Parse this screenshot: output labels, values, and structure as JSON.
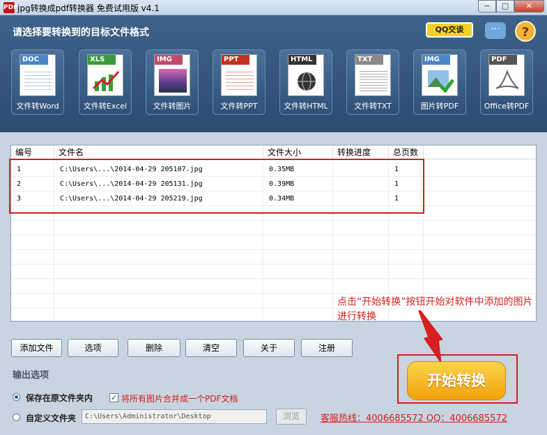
{
  "window": {
    "icon_text": "PDF",
    "title": "jpg转换成pdf转换器 免费试用版 v4.1",
    "min": "−",
    "max": "□",
    "close": "✕"
  },
  "header": {
    "title": "请选择要转换到的目标文件格式",
    "qq_label": "QQ交谈",
    "chat_glyph": "···",
    "help_glyph": "?"
  },
  "tools": [
    {
      "tag": "DOC",
      "tag_color": "#4a86c8",
      "label": "文件转Word",
      "icon": "word-doc-icon"
    },
    {
      "tag": "XLS",
      "tag_color": "#3a9a3a",
      "label": "文件转Excel",
      "icon": "excel-chart-icon"
    },
    {
      "tag": "IMG",
      "tag_color": "#c04a6a",
      "label": "文件转图片",
      "icon": "image-doc-icon"
    },
    {
      "tag": "PPT",
      "tag_color": "#c0321e",
      "label": "文件转PPT",
      "icon": "ppt-doc-icon"
    },
    {
      "tag": "HTML",
      "tag_color": "#333333",
      "label": "文件转HTML",
      "icon": "html-globe-icon"
    },
    {
      "tag": "TXT",
      "tag_color": "#8a8a8a",
      "label": "文件转TXT",
      "icon": "txt-doc-icon"
    },
    {
      "tag": "IMG",
      "tag_color": "#4a86c8",
      "label": "图片转PDF",
      "icon": "image-check-icon"
    },
    {
      "tag": "PDF",
      "tag_color": "#555555",
      "label": "Office转PDF",
      "icon": "pdf-acrobat-icon"
    }
  ],
  "table": {
    "columns": [
      "编号",
      "文件名",
      "文件大小",
      "转换进度",
      "总页数"
    ],
    "rows": [
      {
        "id": "1",
        "name": "C:\\Users\\...\\2014-04-29 205107.jpg",
        "size": "0.35MB",
        "progress": "",
        "pages": "1"
      },
      {
        "id": "2",
        "name": "C:\\Users\\...\\2014-04-29 205131.jpg",
        "size": "0.39MB",
        "progress": "",
        "pages": "1"
      },
      {
        "id": "3",
        "name": "C:\\Users\\...\\2014-04-29 205219.jpg",
        "size": "0.34MB",
        "progress": "",
        "pages": "1"
      }
    ]
  },
  "hint": "点击“开始转换”按钮开始对软件中添加的图片进行转换",
  "buttons": {
    "add_file": "添加文件",
    "options": "选项",
    "delete": "删除",
    "clear": "清空",
    "about": "关于",
    "register": "注册"
  },
  "output": {
    "section_title": "输出选项",
    "save_original": "保存在原文件夹内",
    "merge_label": "将所有图片合并成一个PDF文档",
    "merge_checked": "✓",
    "custom_folder": "自定义文件夹",
    "path": "C:\\Users\\Administrator\\Desktop",
    "browse": "浏览"
  },
  "hotline": "客服热线：4006685572 QQ：4006685572",
  "start_button": "开始转换",
  "colors": {
    "header_bg": "#2c4c72",
    "annotation_red": "#d42020",
    "start_orange": "#f2a20d"
  }
}
